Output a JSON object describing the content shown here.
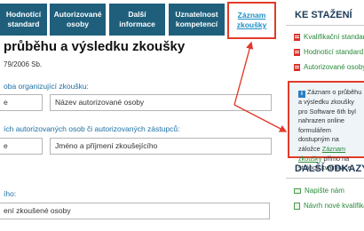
{
  "tabs": [
    {
      "line1": "Hodnotící",
      "line2": "standard"
    },
    {
      "line1": "Autorizované",
      "line2": "osoby"
    },
    {
      "line1": "Další",
      "line2": "informace"
    },
    {
      "line1": "Uznatelnost",
      "line2": "kompetencí"
    },
    {
      "line1": "Záznam",
      "line2": "zkoušky"
    }
  ],
  "main": {
    "title": "průběhu a výsledku zkoušky",
    "subtitle": "79/2006 Sb.",
    "section1_label": "oba organizující zkoušku:",
    "field_short1": "e",
    "field_ao_placeholder": "Název autorizované osoby",
    "section2_label": "ích autorizovaných osob či autorizovaných zástupců:",
    "field_short2": "e",
    "field_examiner_placeholder": "Jméno a příjmení zkoušejícího",
    "section3_label": "ího:",
    "field_candidate_placeholder": "ení zkoušené osoby"
  },
  "sidebar": {
    "downloads_heading": "KE STAŽENÍ",
    "downloads": [
      "Kvalifikační standard",
      "Hodnoticí standard",
      "Autorizované osoby"
    ],
    "notice": {
      "text_before": "Záznam o průběhu a výsledku zkoušky pro Software 6th byl nahrazen online formulářem dostupným na záložce",
      "link": "Záznam zkoušky",
      "text_after": "přímo na stránce kvalifikace."
    },
    "links_heading": "DALŠÍ ODKAZY",
    "links": [
      "Napište nám",
      "Návrh nové kvalifikace"
    ]
  },
  "colors": {
    "tab_bg": "#1f5f7c",
    "accent_link": "#2a8a3a",
    "label_blue": "#1d6fa3",
    "highlight_red": "#e23a2a"
  }
}
